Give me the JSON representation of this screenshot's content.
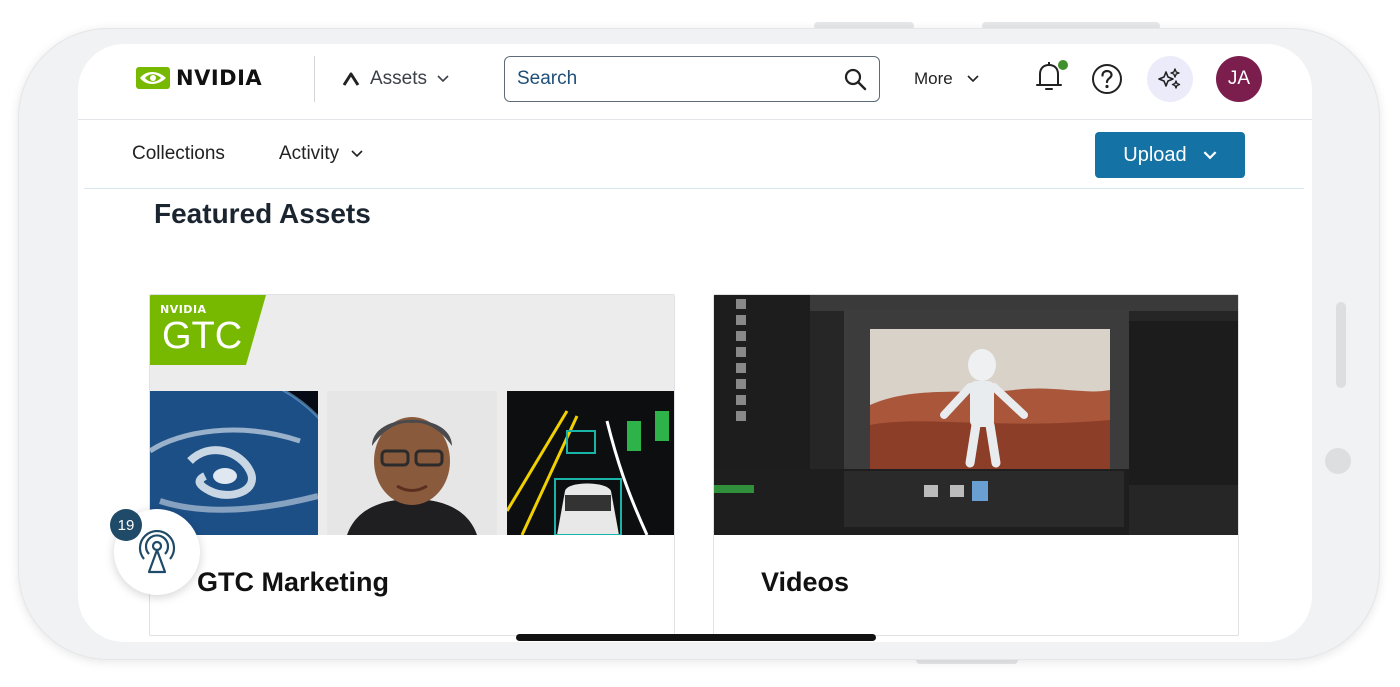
{
  "nav": {
    "logo_text": "NVIDIA",
    "assets_label": "Assets",
    "search_placeholder": "Search",
    "more_label": "More",
    "avatar_initials": "JA"
  },
  "subnav": {
    "collections_label": "Collections",
    "activity_label": "Activity",
    "upload_label": "Upload"
  },
  "main": {
    "section_title": "Featured Assets",
    "cards": [
      {
        "title": "GTC Marketing",
        "brand": "NVIDIA",
        "badge": "GTC"
      },
      {
        "title": "Videos"
      }
    ]
  },
  "floating": {
    "count": "19"
  },
  "colors": {
    "brand_green": "#76b900",
    "primary_blue": "#1572a4",
    "avatar_bg": "#7b1e4e",
    "notification_dot": "#3f8f2a",
    "count_badge": "#1f4a68"
  },
  "icons": [
    "nvidia-logo-icon",
    "caret-up-icon",
    "chevron-down-icon",
    "search-icon",
    "bell-icon",
    "help-icon",
    "sparkle-ai-icon",
    "broadcast-icon"
  ]
}
